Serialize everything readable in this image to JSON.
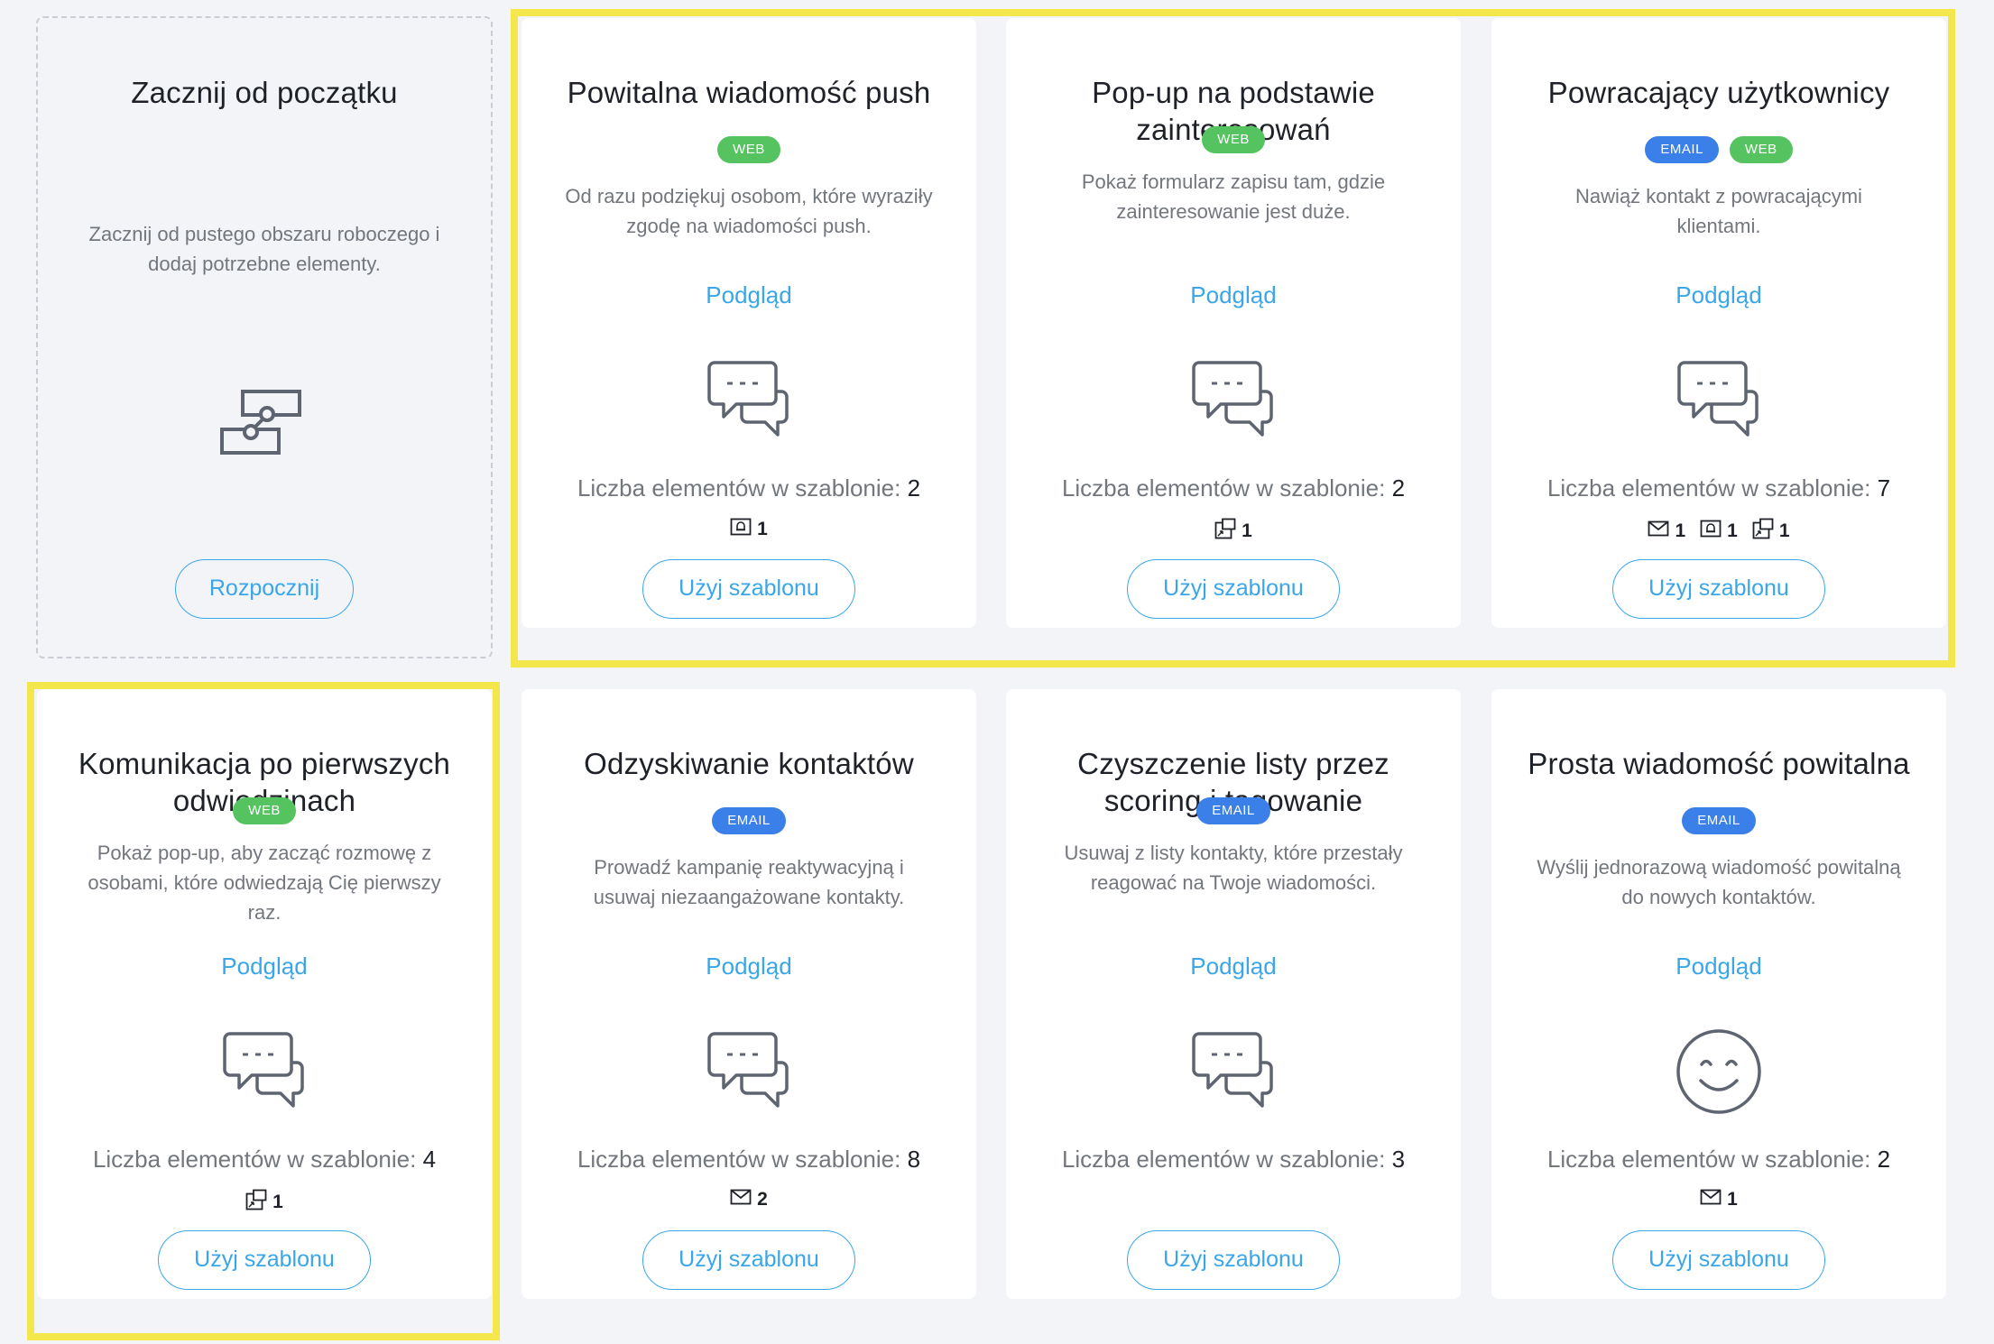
{
  "start_card": {
    "title": "Zacznij od początku",
    "description": "Zacznij od pustego obszaru roboczego i dodaj potrzebne elementy.",
    "button": "Rozpocznij"
  },
  "labels": {
    "preview": "Podgląd",
    "count_prefix": "Liczba elementów w szablonie:",
    "use_button": "Użyj szablonu"
  },
  "templates": [
    {
      "title": "Powitalna wiadomość push",
      "badges": [
        "WEB"
      ],
      "description": "Od razu podziękuj osobom, które wyraziły zgodę na wiadomości push.",
      "icon": "chat-icon",
      "count": "2",
      "types": [
        {
          "icon": "push-icon",
          "count": "1"
        }
      ]
    },
    {
      "title": "Pop-up na podstawie zainteresowań",
      "badges": [
        "WEB"
      ],
      "description": "Pokaż formularz zapisu tam, gdzie zainteresowanie jest duże.",
      "icon": "chat-icon",
      "count": "2",
      "types": [
        {
          "icon": "popup-icon",
          "count": "1"
        }
      ]
    },
    {
      "title": "Powracający użytkownicy",
      "badges": [
        "EMAIL",
        "WEB"
      ],
      "description": "Nawiąż kontakt z powracającymi klientami.",
      "icon": "chat-icon",
      "count": "7",
      "types": [
        {
          "icon": "email-icon",
          "count": "1"
        },
        {
          "icon": "push-icon",
          "count": "1"
        },
        {
          "icon": "popup-icon",
          "count": "1"
        }
      ]
    },
    {
      "title": "Komunikacja po pierwszych odwiedzinach",
      "badges": [
        "WEB"
      ],
      "description": "Pokaż pop-up, aby zacząć rozmowę z osobami, które odwiedzają Cię pierwszy raz.",
      "icon": "chat-icon",
      "count": "4",
      "types": [
        {
          "icon": "popup-icon",
          "count": "1"
        }
      ]
    },
    {
      "title": "Odzyskiwanie kontaktów",
      "badges": [
        "EMAIL"
      ],
      "description": "Prowadź kampanię reaktywacyjną i usuwaj niezaangażowane kontakty.",
      "icon": "chat-icon",
      "count": "8",
      "types": [
        {
          "icon": "email-icon",
          "count": "2"
        }
      ]
    },
    {
      "title": "Czyszczenie listy przez scoring i tagowanie",
      "badges": [
        "EMAIL"
      ],
      "description": "Usuwaj z listy kontakty, które przestały reagować na Twoje wiadomości.",
      "icon": "chat-icon",
      "count": "3",
      "types": []
    },
    {
      "title": "Prosta wiadomość powitalna",
      "badges": [
        "EMAIL"
      ],
      "description": "Wyślij jednorazową wiadomość powitalną do nowych kontaktów.",
      "icon": "smile-icon",
      "count": "2",
      "types": [
        {
          "icon": "email-icon",
          "count": "1"
        }
      ]
    }
  ],
  "colors": {
    "accent": "#3aa6ea",
    "web_badge": "#55c35f",
    "email_badge": "#3b80e8",
    "highlight": "#f4e74b"
  }
}
